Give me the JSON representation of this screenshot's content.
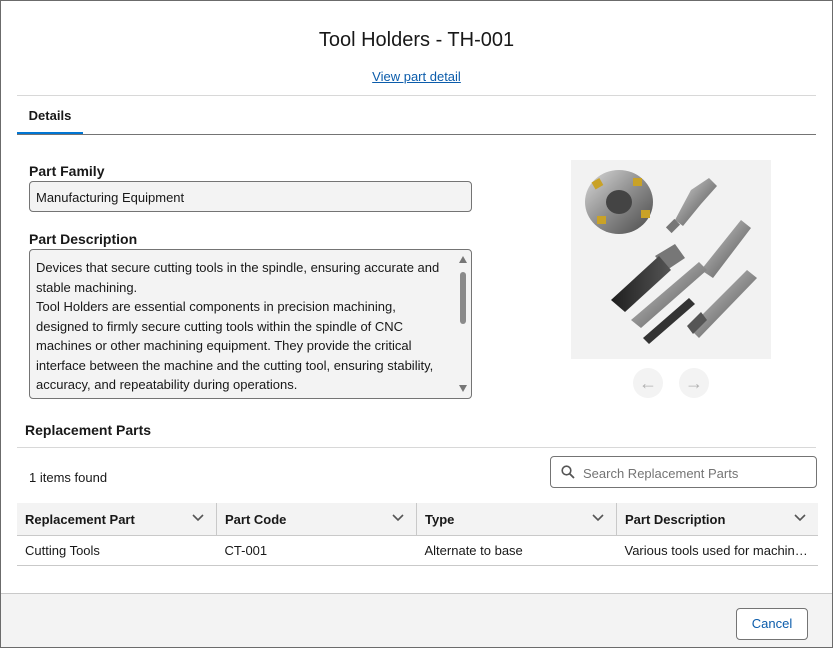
{
  "modal": {
    "title": "Tool Holders - TH-001",
    "view_link": "View part detail"
  },
  "tabs": [
    {
      "label": "Details",
      "active": true
    }
  ],
  "details": {
    "part_family_label": "Part Family",
    "part_family_value": "Manufacturing Equipment",
    "part_description_label": "Part Description",
    "part_description_paragraphs": [
      "Devices that secure cutting tools in the spindle, ensuring accurate and stable machining.",
      "Tool Holders are essential components in precision machining, designed to firmly secure cutting tools within the spindle of CNC machines or other machining equipment. They provide the critical interface between the machine and the cutting tool, ensuring stability, accuracy, and repeatability during operations."
    ]
  },
  "carousel": {
    "prev_icon": "arrow-left-icon",
    "next_icon": "arrow-right-icon",
    "prev_glyph": "←",
    "next_glyph": "→"
  },
  "replacement_parts": {
    "title": "Replacement Parts",
    "count_text": "1 items found",
    "search_placeholder": "Search Replacement Parts",
    "columns": [
      "Replacement Part",
      "Part Code",
      "Type",
      "Part Description"
    ],
    "rows": [
      [
        "Cutting Tools",
        "CT-001",
        "Alternate to base",
        "Various tools used for machining operations"
      ]
    ]
  },
  "footer": {
    "cancel_label": "Cancel"
  },
  "colors": {
    "accent": "#0176d3",
    "link": "#0b5cab",
    "field_bg": "#f3f3f3"
  }
}
